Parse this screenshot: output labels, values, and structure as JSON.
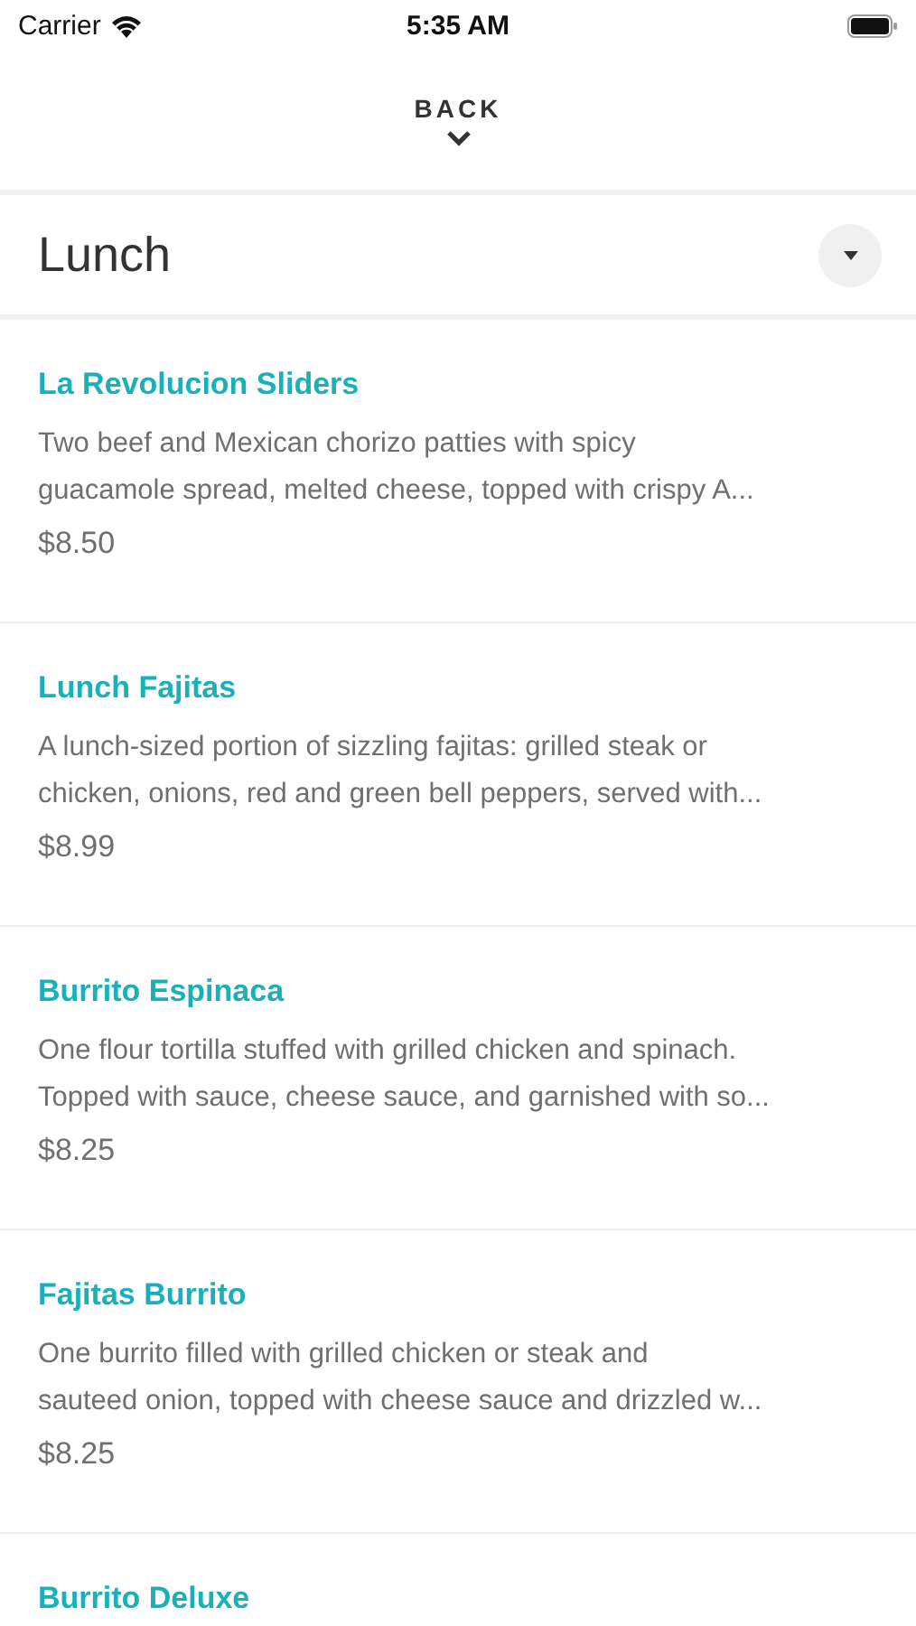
{
  "status_bar": {
    "carrier": "Carrier",
    "time": "5:35 AM"
  },
  "back": {
    "label": "BACK"
  },
  "section": {
    "title": "Lunch",
    "expanded": true
  },
  "items": [
    {
      "name": "La Revolucion Sliders",
      "description_lines": [
        "Two beef and Mexican chorizo patties with spicy",
        "guacamole spread, melted cheese, topped with crispy A..."
      ],
      "price": "$8.50"
    },
    {
      "name": "Lunch Fajitas",
      "description_lines": [
        "A lunch-sized portion of sizzling fajitas: grilled steak or",
        "chicken, onions, red and green bell peppers, served with..."
      ],
      "price": "$8.99"
    },
    {
      "name": "Burrito Espinaca",
      "description_lines": [
        "One flour tortilla stuffed with grilled chicken and spinach.",
        "Topped with sauce, cheese sauce, and garnished with so..."
      ],
      "price": "$8.25"
    },
    {
      "name": "Fajitas Burrito",
      "description_lines": [
        "One burrito filled with grilled chicken or steak and",
        "sauteed onion, topped with cheese sauce and drizzled w..."
      ],
      "price": "$8.25"
    },
    {
      "name": "Burrito Deluxe"
    }
  ]
}
